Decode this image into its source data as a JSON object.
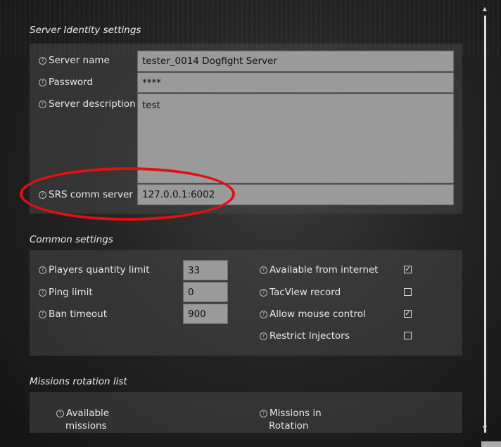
{
  "identity": {
    "title": "Server Identity settings",
    "server_name": {
      "label": "Server name",
      "value": "tester_0014 Dogfight Server"
    },
    "password": {
      "label": "Password",
      "value": "****"
    },
    "description": {
      "label": "Server description",
      "value": "test"
    },
    "srs": {
      "label": "SRS comm server",
      "value": "127.0.0.1:6002"
    }
  },
  "common": {
    "title": "Common settings",
    "players_limit": {
      "label": "Players quantity limit",
      "value": "33"
    },
    "ping_limit": {
      "label": "Ping limit",
      "value": "0"
    },
    "ban_timeout": {
      "label": "Ban timeout",
      "value": "900"
    },
    "available_internet": {
      "label": "Available from internet",
      "checked": true
    },
    "tacview": {
      "label": "TacView record",
      "checked": false
    },
    "mouse_control": {
      "label": "Allow mouse control",
      "checked": true
    },
    "restrict_injectors": {
      "label": "Restrict Injectors",
      "checked": false
    }
  },
  "missions": {
    "title": "Missions rotation list",
    "available_line1": "Available",
    "available_line2": "missions",
    "rotation_line1": "Missions in",
    "rotation_line2": "Rotation"
  },
  "icons": {
    "help": "?",
    "check": "✓",
    "scroll_up": "▲",
    "scroll_down": "▼"
  },
  "colors": {
    "highlight": "#e01010"
  }
}
